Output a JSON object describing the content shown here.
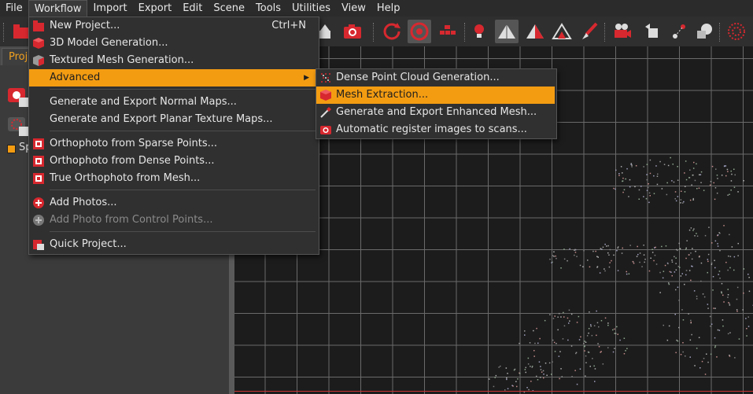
{
  "menubar": {
    "items": [
      "File",
      "Workflow",
      "Import",
      "Export",
      "Edit",
      "Scene",
      "Tools",
      "Utilities",
      "View",
      "Help"
    ],
    "active": "Workflow"
  },
  "toolbar": {
    "icons": [
      "new-project-icon",
      "upload-icon",
      "camera-icon",
      "refresh-icon",
      "target-icon",
      "grid-icon",
      "lightbulb-icon",
      "mesh-solid-icon",
      "mesh-textured-icon",
      "mesh-wire-icon",
      "brush-icon",
      "video-camera-icon",
      "paste-icon",
      "node-icon",
      "tools-icon",
      "sphere-icon"
    ]
  },
  "left_panel": {
    "tab_label": "Proj",
    "item_label": "Sp"
  },
  "workflow_menu": {
    "items": [
      {
        "label": "New Project...",
        "shortcut": "Ctrl+N",
        "icon": "new-project-icon"
      },
      {
        "label": "3D Model Generation...",
        "icon": "cube-icon"
      },
      {
        "label": "Textured Mesh Generation...",
        "icon": "textured-cube-icon"
      },
      {
        "label": "Advanced",
        "has_submenu": true
      },
      {
        "label": "Generate and Export Normal Maps..."
      },
      {
        "label": "Generate and Export Planar Texture Maps..."
      },
      {
        "label": "Orthophoto from Sparse Points...",
        "icon": "orthophoto-icon"
      },
      {
        "label": "Orthophoto from Dense Points...",
        "icon": "orthophoto-icon"
      },
      {
        "label": "True Orthophoto from Mesh...",
        "icon": "orthophoto-icon"
      },
      {
        "label": "Add Photos...",
        "icon": "add-icon"
      },
      {
        "label": "Add Photo from Control Points...",
        "icon": "add-icon",
        "disabled": true
      },
      {
        "label": "Quick Project...",
        "icon": "quick-project-icon"
      }
    ]
  },
  "advanced_menu": {
    "items": [
      {
        "label": "Dense Point Cloud Generation...",
        "icon": "dense-cloud-icon"
      },
      {
        "label": "Mesh Extraction...",
        "icon": "mesh-icon",
        "highlighted": true
      },
      {
        "label": "Generate and Export Enhanced Mesh...",
        "icon": "wand-icon"
      },
      {
        "label": "Automatic register images to scans...",
        "icon": "camera-icon"
      }
    ]
  },
  "colors": {
    "accent": "#f39c12",
    "brand_red": "#d7282f",
    "menu_bg": "#303030"
  }
}
